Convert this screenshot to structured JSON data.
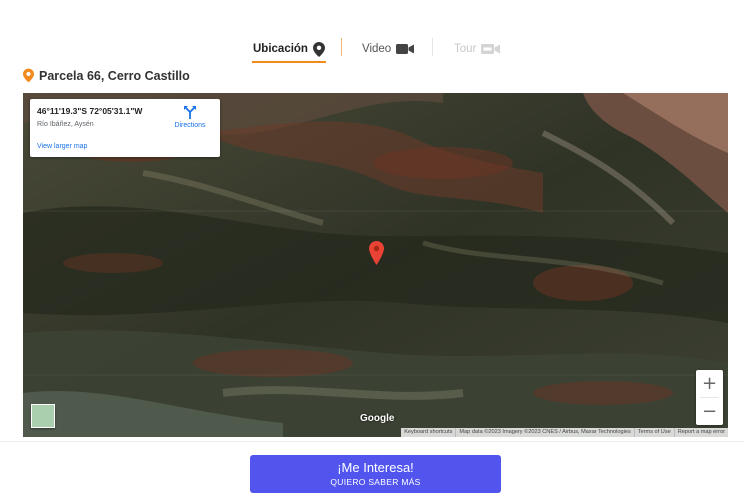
{
  "tabs": [
    {
      "label": "Ubicación",
      "icon": "map-pin-icon",
      "active": true
    },
    {
      "label": "Video",
      "icon": "video-camera-icon",
      "active": false
    },
    {
      "label": "Tour",
      "icon": "tour-360-icon",
      "active": false,
      "disabled": true
    }
  ],
  "location": {
    "title": "Parcela 66, Cerro Castillo",
    "icon": "map-pin-icon",
    "color": "#f28a1e"
  },
  "map": {
    "coords": "46°11'19.3\"S 72°05'31.1\"W",
    "place": "Río Ibáñez, Aysén",
    "view_larger": "View larger map",
    "directions": "Directions",
    "zoom_in": "+",
    "zoom_out": "−",
    "google": "Google",
    "attribution": [
      "Keyboard shortcuts",
      "Map data ©2023 Imagery ©2023 CNES / Airbus, Maxar Technologies",
      "Terms of Use",
      "Report a map error"
    ]
  },
  "cta": {
    "title": "¡Me Interesa!",
    "subtitle": "QUIERO SABER MÁS",
    "color": "#5155ee"
  }
}
